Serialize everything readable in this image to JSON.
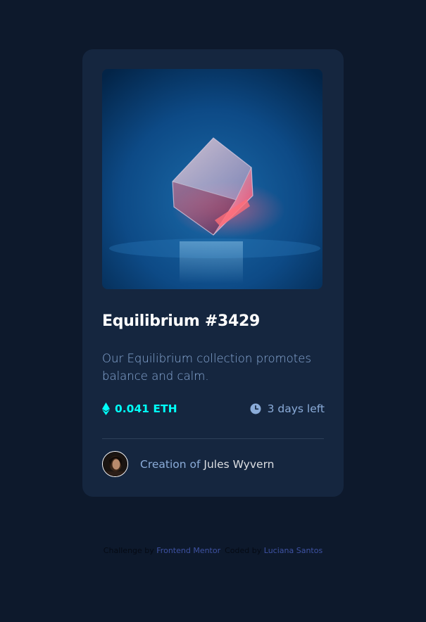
{
  "card": {
    "title": "Equilibrium #3429",
    "description": "Our Equilibrium collection promotes balance and calm.",
    "price": "0.041 ETH",
    "time_left": "3 days left",
    "creator_prefix": "Creation of",
    "creator_name": "Jules Wyvern",
    "icons": {
      "price": "ethereum-icon",
      "time": "clock-icon",
      "avatar": "creator-avatar"
    }
  },
  "attribution": {
    "challenge_prefix": "Challenge by",
    "challenge_link": "Frontend Mentor",
    "coded_prefix": "Coded by",
    "coded_link": "Luciana Santos"
  },
  "colors": {
    "page_background": "#0d192c",
    "card_background": "#15263f",
    "accent": "#00fff8",
    "soft_blue": "#8bacd9",
    "link": "#3e52a3"
  }
}
